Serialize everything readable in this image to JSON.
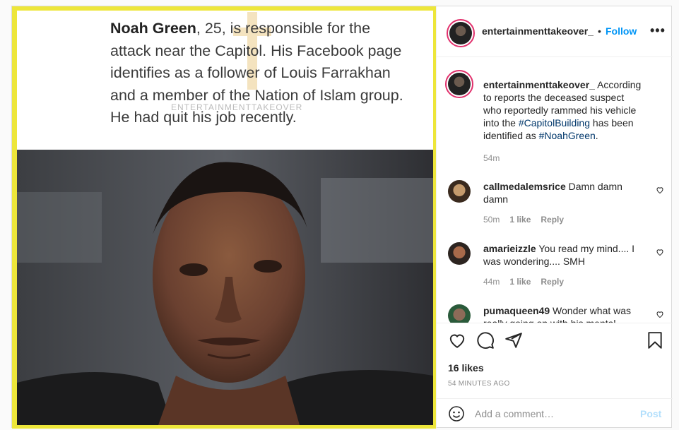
{
  "post": {
    "image": {
      "caption_name": "Noah Green",
      "caption_rest": ", 25, is responsible for the attack near the Capitol. His Facebook page identifies as a follower of Louis Farrakhan and a member of the Nation of Islam group. He had quit his job recently.",
      "watermark": "ENTERTAINMENTTAKEOVER"
    },
    "header": {
      "username": "entertainmenttakeover_",
      "separator": "•",
      "follow_label": "Follow",
      "more_label": "•••"
    },
    "caption": {
      "username": "entertainmenttakeover_",
      "text_1": " According to reports the deceased suspect who reportedly rammed his vehicle into the ",
      "tag_1": "#CapitolBuilding",
      "text_2": " has been identified as ",
      "tag_2": "#NoahGreen",
      "text_3": ".",
      "time": "54m"
    },
    "comments": [
      {
        "username": "callmedalemsrice",
        "text": " Damn damn damn",
        "time": "50m",
        "likes": "1 like",
        "reply": "Reply"
      },
      {
        "username": "amarieizzle",
        "text": " You read my mind.... I was wondering.... SMH",
        "time": "44m",
        "likes": "1 like",
        "reply": "Reply"
      },
      {
        "username": "pumaqueen49",
        "text": " Wonder what was really going on with his mental"
      }
    ],
    "likes": "16 likes",
    "timestamp": "54 MINUTES AGO",
    "add_comment": {
      "placeholder": "Add a comment…",
      "post_label": "Post"
    }
  },
  "colors": {
    "accent": "#0095f6",
    "frame": "#ede63a",
    "hashtag": "#00376b"
  }
}
